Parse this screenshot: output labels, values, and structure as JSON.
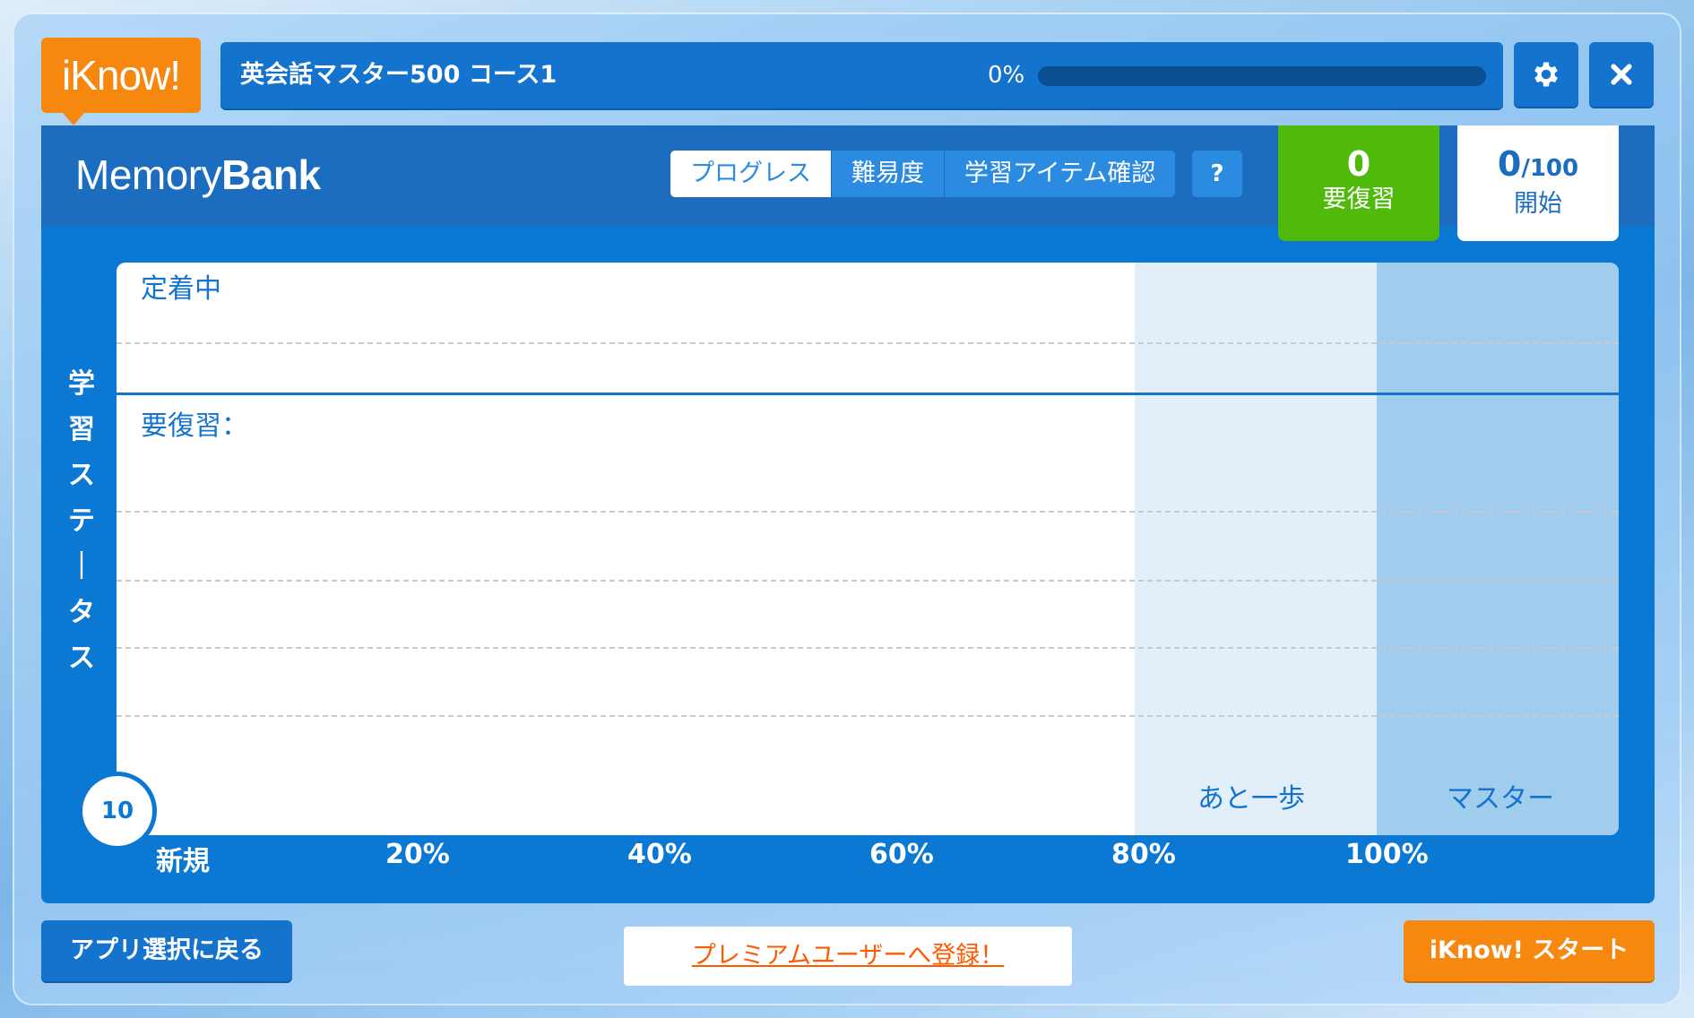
{
  "logo": {
    "text": "iKnow!"
  },
  "course": {
    "title": "英会話マスター500 コース1",
    "progress_text": "0%",
    "progress_value": 0
  },
  "toolbar": {
    "settings_icon": "gear-icon",
    "close_icon": "close-icon"
  },
  "memory_bank": {
    "title_light": "Memory",
    "title_bold": "Bank"
  },
  "tabs": [
    {
      "label": "プログレス",
      "active": true
    },
    {
      "label": "難易度",
      "active": false
    },
    {
      "label": "学習アイテム確認",
      "active": false
    }
  ],
  "help_label": "?",
  "stats": {
    "review": {
      "value": "0",
      "label": "要復習"
    },
    "started": {
      "value": "0",
      "total": "/100",
      "label": "開始"
    }
  },
  "chart": {
    "y_axis_label": "学習ステータス",
    "section_settled": "定着中",
    "section_review": "要復習：",
    "zone_near": "あと一歩",
    "zone_master": "マスター",
    "new_count": "10",
    "x_labels": [
      "新規",
      "20%",
      "40%",
      "60%",
      "80%",
      "100%"
    ]
  },
  "colors": {
    "primary": "#1473cc",
    "accent_orange": "#f6870f",
    "review_green": "#4fba0c",
    "premium_link": "#ff5a00"
  },
  "footer": {
    "back_label": "アプリ選択に戻る",
    "premium_label": "プレミアムユーザーへ登録！",
    "start_label": "iKnow! スタート"
  }
}
